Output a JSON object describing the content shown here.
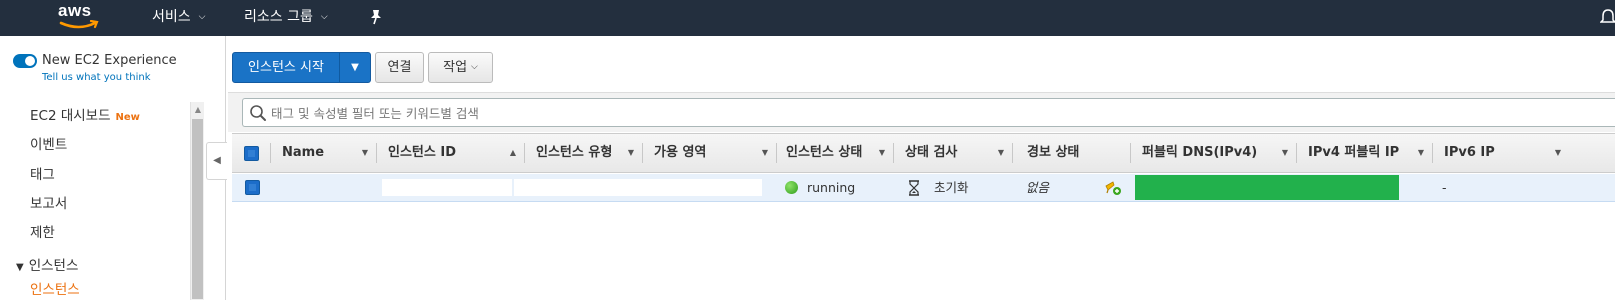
{
  "topnav": {
    "logo_text": "aws",
    "services_label": "서비스",
    "resource_groups_label": "리소스 그룹",
    "pin_icon": "pin-icon",
    "bell_icon": "bell-icon"
  },
  "sidebar": {
    "experience_label": "New EC2 Experience",
    "experience_link": "Tell us what you think",
    "items": [
      {
        "label": "EC2 대시보드",
        "badge": "New"
      },
      {
        "label": "이벤트"
      },
      {
        "label": "태그"
      },
      {
        "label": "보고서"
      },
      {
        "label": "제한"
      }
    ],
    "section_label": "인스턴스",
    "section_child": "인스턴스"
  },
  "toolbar": {
    "launch_label": "인스턴스 시작",
    "connect_label": "연결",
    "actions_label": "작업"
  },
  "search": {
    "placeholder": "태그 및 속성별 필터 또는 키워드별 검색"
  },
  "table": {
    "columns": [
      "Name",
      "인스턴스 ID",
      "인스턴스 유형",
      "가용 영역",
      "인스턴스 상태",
      "상태 검사",
      "경보 상태",
      "퍼블릭 DNS(IPv4)",
      "IPv4 퍼블릭 IP",
      "IPv6 IP"
    ],
    "rows": [
      {
        "name": "",
        "instance_id": "",
        "instance_type": "",
        "availability_zone": "",
        "instance_state": "running",
        "status_check": "초기화",
        "alarm_status": "없음",
        "public_dns": "",
        "ipv4_public_ip": "",
        "ipv6_ip": "-"
      }
    ]
  },
  "colors": {
    "nav_bg": "#232f3e",
    "primary_button": "#1a73c6",
    "accent_orange": "#ec7211",
    "selected_row": "#e8f1fb",
    "running_green": "#3aa61f",
    "redaction_green": "#22b14c"
  }
}
